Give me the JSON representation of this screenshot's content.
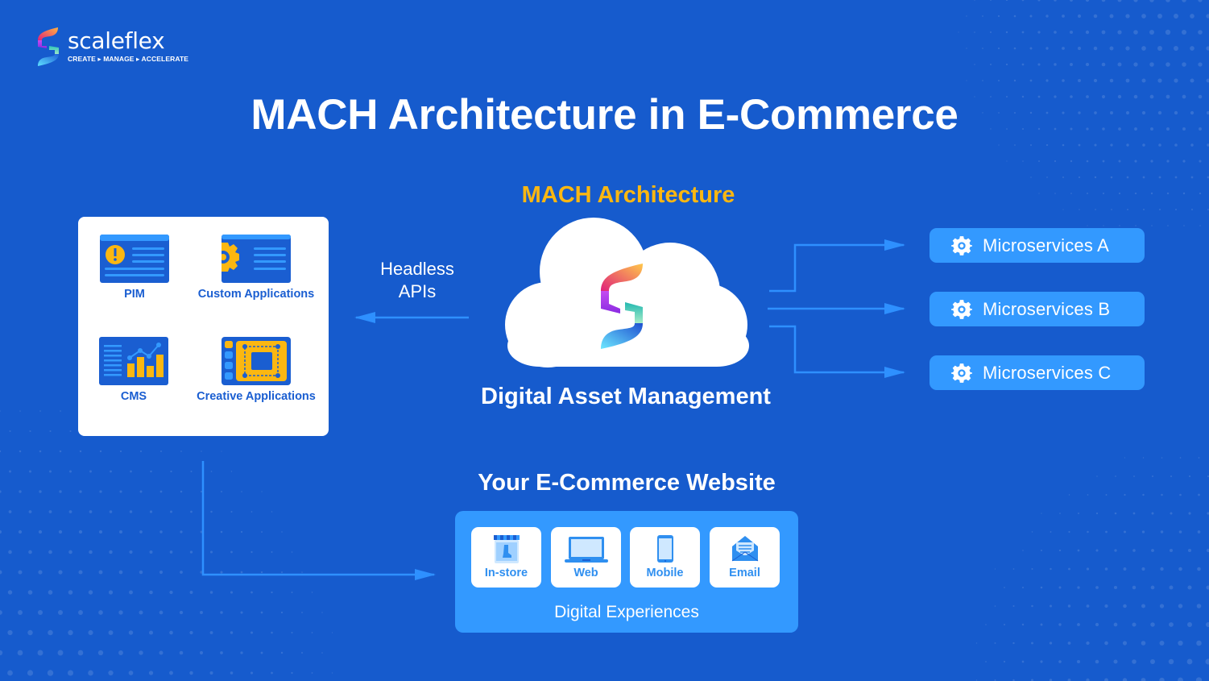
{
  "brand": {
    "name": "scaleflex",
    "tagline": "CREATE ▸ MANAGE ▸ ACCELERATE"
  },
  "title": "MACH Architecture in E-Commerce",
  "colors": {
    "background": "#165bcd",
    "accent_yellow": "#fbb711",
    "accent_light_blue": "#3399ff",
    "card_text_blue": "#1a5ed1"
  },
  "applications": [
    {
      "label": "PIM",
      "icon": "pim-card-icon"
    },
    {
      "label": "Custom Applications",
      "icon": "gear-card-icon"
    },
    {
      "label": "CMS",
      "icon": "chart-card-icon"
    },
    {
      "label": "Creative Applications",
      "icon": "design-frame-icon"
    }
  ],
  "headless": {
    "line1": "Headless",
    "line2": "APIs"
  },
  "center": {
    "architecture_label": "MACH Architecture",
    "dam_label": "Digital Asset Management"
  },
  "microservices": [
    {
      "label": "Microservices A",
      "icon": "gear-icon"
    },
    {
      "label": "Microservices B",
      "icon": "gear-icon"
    },
    {
      "label": "Microservices C",
      "icon": "gear-icon"
    }
  ],
  "website": {
    "title": "Your E-Commerce Website",
    "channels": [
      {
        "label": "In-store",
        "icon": "storefront-icon"
      },
      {
        "label": "Web",
        "icon": "laptop-icon"
      },
      {
        "label": "Mobile",
        "icon": "smartphone-icon"
      },
      {
        "label": "Email",
        "icon": "envelope-icon"
      }
    ],
    "caption": "Digital Experiences"
  }
}
